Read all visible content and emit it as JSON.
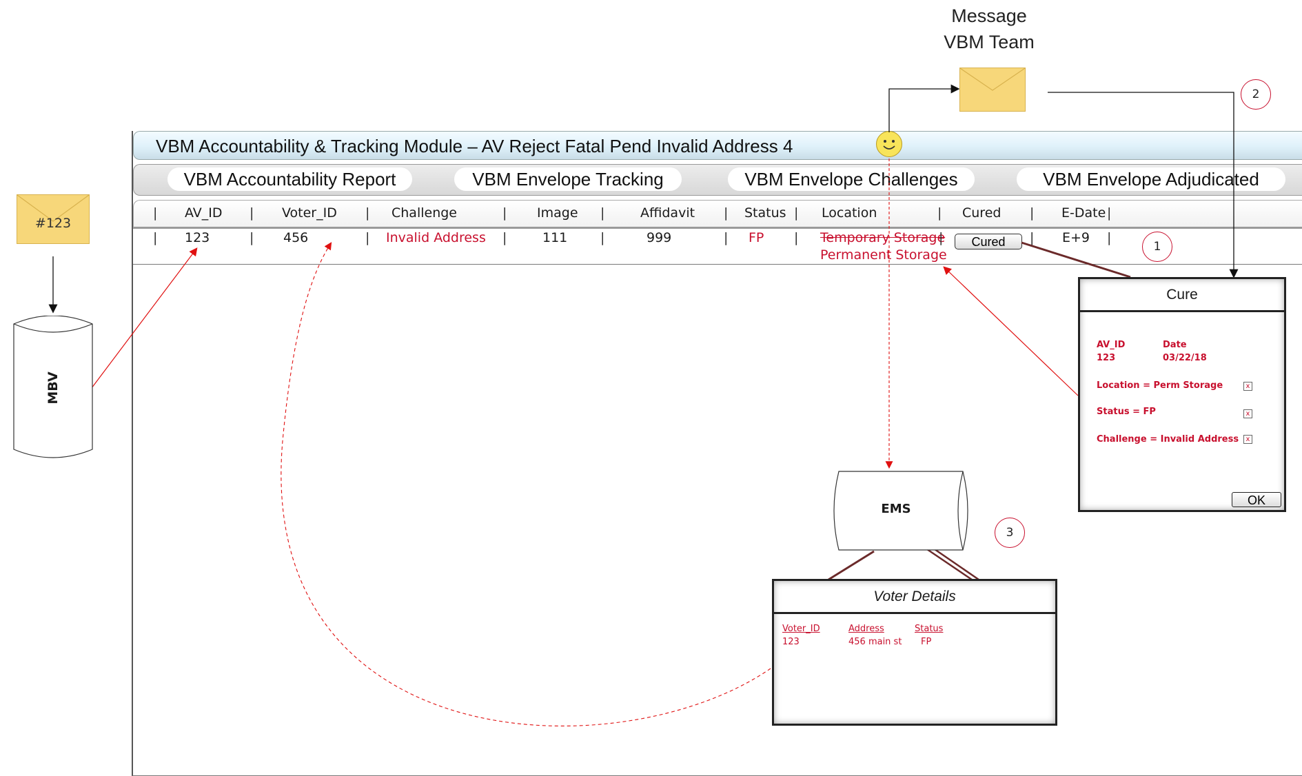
{
  "window": {
    "title": "VBM Accountability & Tracking Module – AV Reject Fatal Pend Invalid Address 4"
  },
  "tabs": [
    {
      "label": "VBM Accountability Report"
    },
    {
      "label": "VBM Envelope Tracking"
    },
    {
      "label": "VBM Envelope Challenges"
    },
    {
      "label": "VBM Envelope Adjudicated"
    }
  ],
  "table": {
    "columns": [
      "AV_ID",
      "Voter_ID",
      "Challenge",
      "Image",
      "Affidavit",
      "Status",
      "Location",
      "Cured",
      "E-Date"
    ],
    "row": {
      "av_id": "123",
      "voter_id": "456",
      "challenge": "Invalid Address",
      "image": "111",
      "affidavit": "999",
      "status": "FP",
      "location_old": "Temporary Storage",
      "location_new": "Permanent Storage",
      "cured_button": "Cured",
      "edate": "E+9"
    }
  },
  "envelope_left": {
    "label": "#123"
  },
  "mbv": {
    "label": "MBV"
  },
  "message": {
    "line1": "Message",
    "line2": "VBM Team"
  },
  "callouts": [
    "1",
    "2",
    "3"
  ],
  "cure_dialog": {
    "title": "Cure",
    "av_id_label": "AV_ID",
    "av_id_value": "123",
    "date_label": "Date",
    "date_value": "03/22/18",
    "location_line": "Location = Perm Storage",
    "status_line": "Status = FP",
    "challenge_line": "Challenge =  Invalid Address",
    "checkbox_mark": "x",
    "ok_label": "OK"
  },
  "ems": {
    "label": "EMS"
  },
  "voter_details": {
    "title": "Voter Details",
    "headers": [
      "Voter_ID",
      "Address",
      "Status"
    ],
    "values": [
      "123",
      "456 main st",
      "FP"
    ]
  },
  "colors": {
    "accent_red": "#c8102e",
    "envelope": "#f7d77a",
    "titlebar": "#dff1fa"
  },
  "icons": [
    "envelope-icon",
    "smiley-icon",
    "database-icon",
    "checkbox-icon"
  ]
}
